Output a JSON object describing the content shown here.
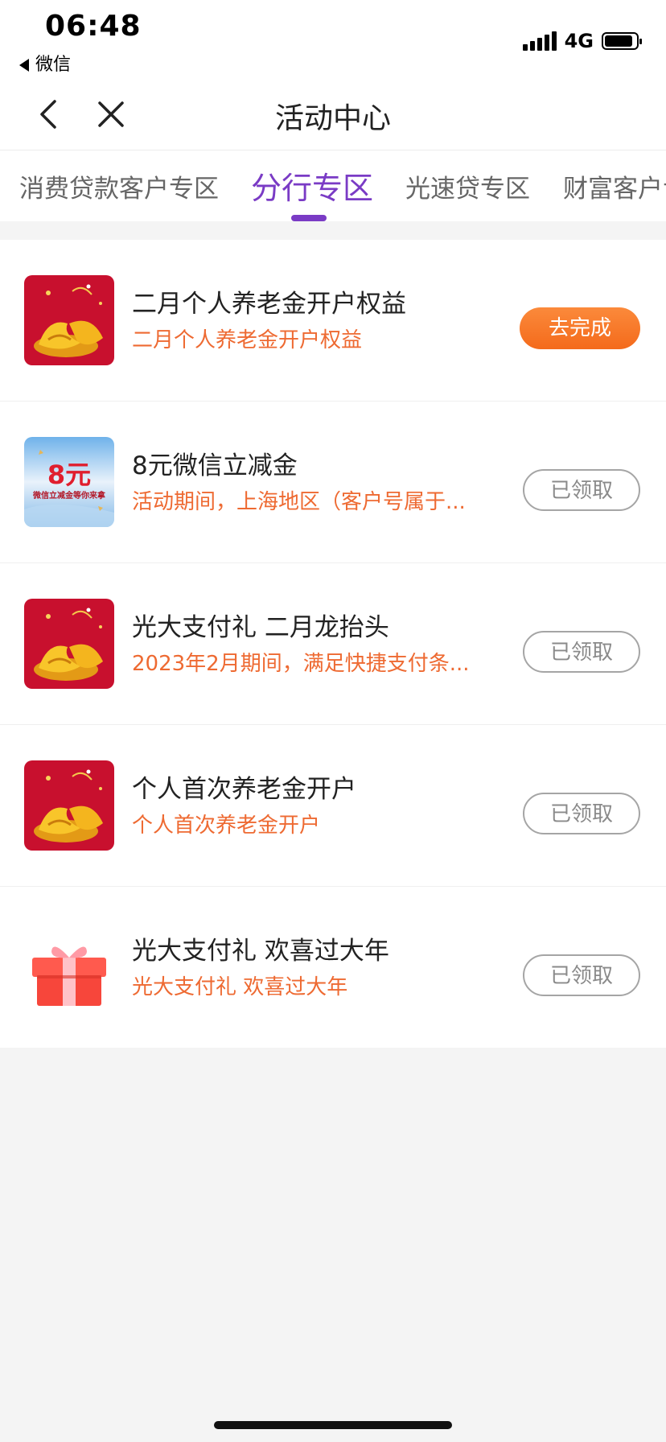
{
  "status_bar": {
    "time": "06:48",
    "back_app": "微信",
    "network": "4G",
    "battery_level": 0.9
  },
  "nav": {
    "title": "活动中心",
    "back_icon": "chevron-left-icon",
    "close_icon": "close-icon"
  },
  "tabs": [
    {
      "label": "消费贷款客户专区",
      "active": false
    },
    {
      "label": "分行专区",
      "active": true
    },
    {
      "label": "光速贷专区",
      "active": false
    },
    {
      "label": "财富客户专区",
      "active": false
    }
  ],
  "colors": {
    "accent": "#7a3bc5",
    "subtitle": "#ee6a32",
    "primary_button": "#f46a1b"
  },
  "activities": [
    {
      "title": "二月个人养老金开户权益",
      "subtitle": "二月个人养老金开户权益",
      "button": "去完成",
      "button_state": "primary",
      "thumb": "red-gold-coin"
    },
    {
      "title": "8元微信立减金",
      "subtitle": "活动期间，上海地区（客户号属于...",
      "button": "已领取",
      "button_state": "claimed",
      "thumb": "wechat-voucher",
      "thumb_text": "8元",
      "thumb_caption": "微信立减金等你来拿"
    },
    {
      "title": "光大支付礼 二月龙抬头",
      "subtitle": "2023年2月期间，满足快捷支付条...",
      "button": "已领取",
      "button_state": "claimed",
      "thumb": "red-gold-coin"
    },
    {
      "title": "个人首次养老金开户",
      "subtitle": "个人首次养老金开户",
      "button": "已领取",
      "button_state": "claimed",
      "thumb": "red-gold-coin"
    },
    {
      "title": "光大支付礼 欢喜过大年",
      "subtitle": "光大支付礼 欢喜过大年",
      "button": "已领取",
      "button_state": "claimed",
      "thumb": "gift-box"
    }
  ]
}
